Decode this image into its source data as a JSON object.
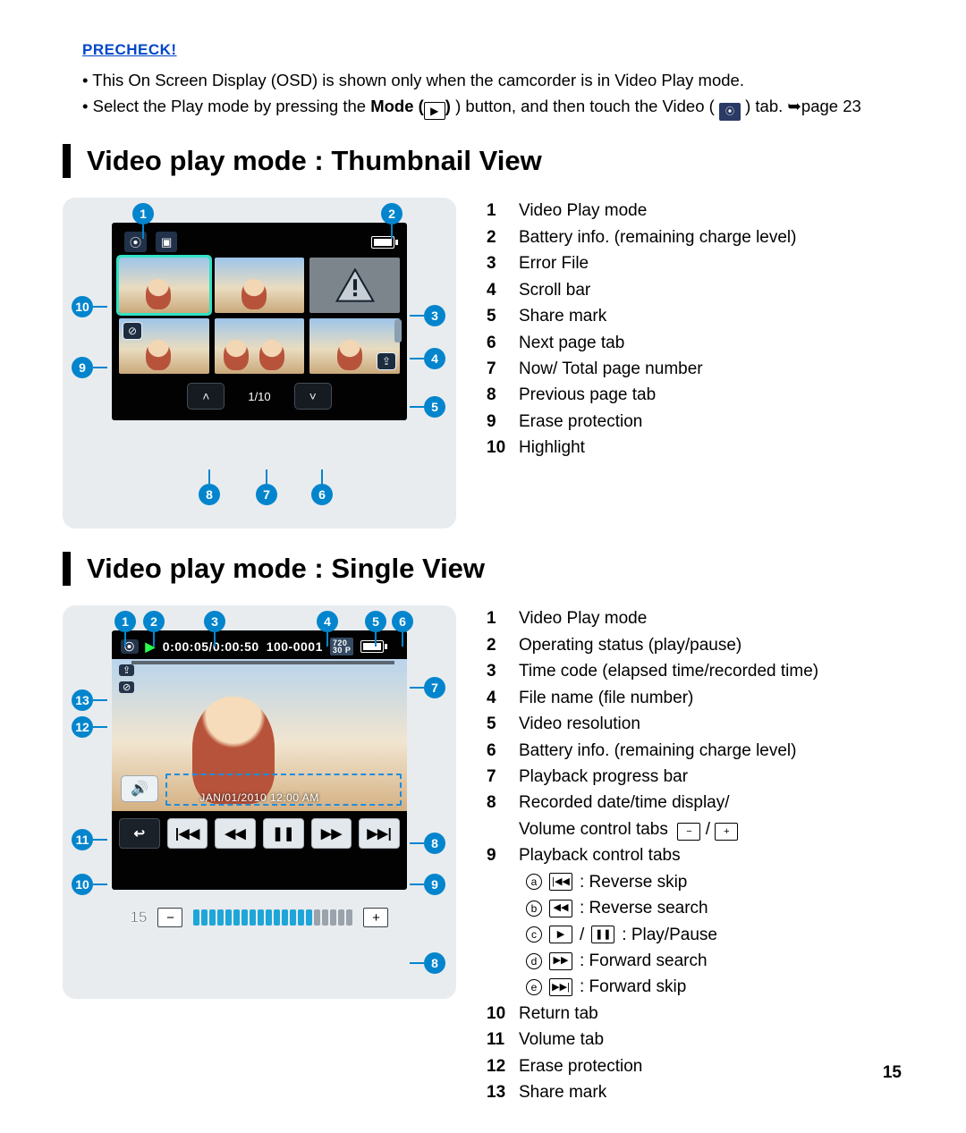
{
  "precheck": {
    "title": "PRECHECK!",
    "item1_a": "This On Screen Display (OSD) is shown only when the camcorder is in Video Play mode.",
    "item2_a": "Select the Play mode by pressing the ",
    "item2_b": "Mode (",
    "item2_c": ") button, and then touch the Video (",
    "item2_d": ") tab. ➥page 23"
  },
  "section1": {
    "title": "Video play mode : Thumbnail View",
    "pager": "1/10",
    "legend": [
      "Video Play mode",
      "Battery info. (remaining charge level)",
      "Error File",
      "Scroll bar",
      "Share mark",
      "Next page tab",
      "Now/ Total page number",
      "Previous page tab",
      "Erase protection",
      "Highlight"
    ]
  },
  "section2": {
    "title": "Video play mode : Single View",
    "timecode": "0:00:05/0:00:50",
    "filenum": "100-0001",
    "res_top": "720",
    "res_bot": "30 P",
    "date": "JAN/01/2010 12:00 AM",
    "volume_level": "15",
    "legend": [
      "Video Play mode",
      "Operating status (play/pause)",
      "Time code (elapsed time/recorded time)",
      "File name (file number)",
      "Video resolution",
      "Battery info. (remaining charge level)",
      "Playback progress bar",
      "Recorded date/time display/",
      "Playback control tabs",
      "Return tab",
      "Volume tab",
      "Erase protection",
      "Share mark"
    ],
    "legend8_extra": "Volume control tabs",
    "sub": {
      "a": ": Reverse skip",
      "b": ": Reverse search",
      "c": ": Play/Pause",
      "d": ": Forward search",
      "e": ": Forward skip"
    }
  },
  "page_number": "15"
}
